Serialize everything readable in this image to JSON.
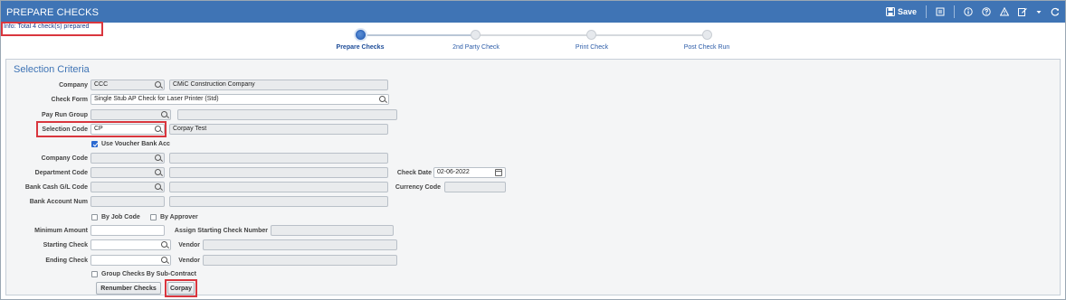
{
  "header": {
    "title": "PREPARE CHECKS",
    "save_label": "Save",
    "icons": [
      "save-icon",
      "notes-icon",
      "info-icon",
      "help-icon",
      "warning-icon",
      "edit-icon",
      "dropdown-icon",
      "refresh-icon"
    ]
  },
  "info_message": "Info: Total 4 check(s) prepared",
  "train": {
    "steps": [
      {
        "label": "Prepare Checks",
        "active": true
      },
      {
        "label": "2nd Party Check",
        "active": false
      },
      {
        "label": "Print Check",
        "active": false
      },
      {
        "label": "Post Check Run",
        "active": false
      }
    ]
  },
  "selection": {
    "title": "Selection Criteria",
    "company": {
      "label": "Company",
      "value": "CCC",
      "desc": "CMiC Construction Company"
    },
    "check_form": {
      "label": "Check Form",
      "value": "Single Stub AP Check for Laser Printer (Std)"
    },
    "pay_run_group": {
      "label": "Pay Run Group",
      "value": "",
      "desc": ""
    },
    "selection_code": {
      "label": "Selection Code",
      "value": "CP",
      "desc": "Corpay Test"
    },
    "use_voucher_bank": {
      "label": "Use Voucher Bank Acc",
      "checked": true
    },
    "company_code": {
      "label": "Company Code",
      "value": "",
      "desc": ""
    },
    "department_code": {
      "label": "Department Code",
      "value": "",
      "desc": ""
    },
    "bank_cash_gl": {
      "label": "Bank Cash G/L Code",
      "value": "",
      "desc": ""
    },
    "bank_account_num": {
      "label": "Bank Account Num",
      "value": "",
      "desc": ""
    },
    "check_date": {
      "label": "Check Date",
      "value": "02-06-2022"
    },
    "currency_code": {
      "label": "Currency Code",
      "value": ""
    },
    "by_job_code": {
      "label": "By Job Code",
      "checked": false
    },
    "by_approver": {
      "label": "By Approver",
      "checked": false
    },
    "minimum_amount": {
      "label": "Minimum Amount",
      "value": ""
    },
    "assign_starting": {
      "label": "Assign Starting Check Number",
      "value": ""
    },
    "starting_check": {
      "label": "Starting Check",
      "value": ""
    },
    "ending_check": {
      "label": "Ending Check",
      "value": ""
    },
    "vendor_label": "Vendor",
    "vendor_start_value": "",
    "vendor_end_value": "",
    "group_by_subcontract": {
      "label": "Group Checks By Sub-Contract",
      "checked": false
    },
    "renumber_button": "Renumber Checks",
    "corpay_button": "Corpay"
  },
  "colors": {
    "header_bg": "#3f74b5",
    "highlight": "#d9363e",
    "accent_blue": "#2c63b8"
  }
}
